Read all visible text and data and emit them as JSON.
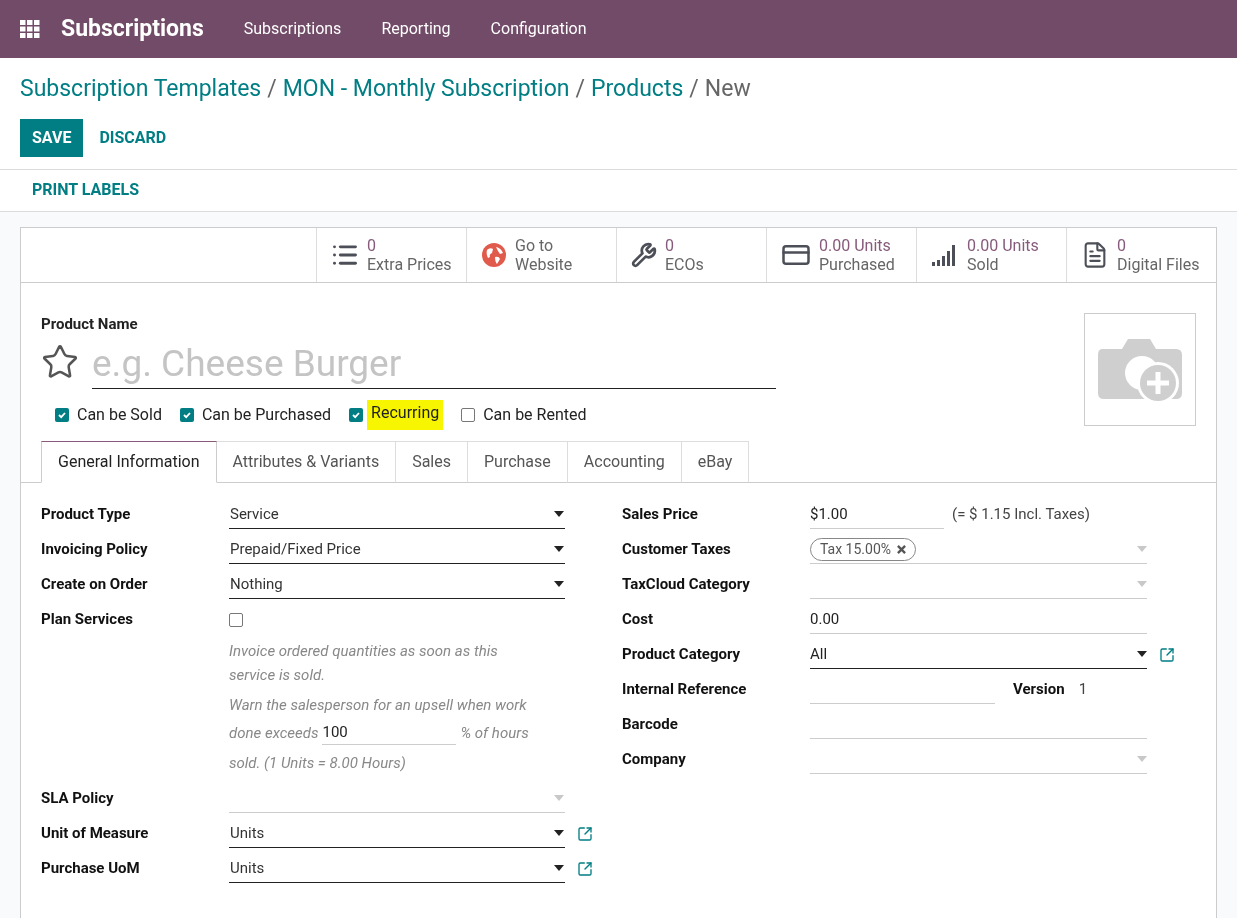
{
  "navbar": {
    "app_name": "Subscriptions",
    "menu": [
      {
        "label": "Subscriptions"
      },
      {
        "label": "Reporting"
      },
      {
        "label": "Configuration"
      }
    ]
  },
  "breadcrumbs": [
    {
      "label": "Subscription Templates",
      "separator": "/"
    },
    {
      "label": "MON - Monthly Subscription",
      "separator": "/"
    },
    {
      "label": "Products",
      "separator": "/"
    }
  ],
  "breadcrumb_current": "New",
  "actions": {
    "save": "SAVE",
    "discard": "DISCARD"
  },
  "print_labels": "PRINT LABELS",
  "smart_buttons": [
    {
      "kind": "list",
      "value": "0",
      "label": "Extra Prices"
    },
    {
      "kind": "globe",
      "title_lines": [
        "Go to",
        "Website"
      ]
    },
    {
      "kind": "wrench",
      "value": "0",
      "label": "ECOs"
    },
    {
      "kind": "card",
      "value": "0.00 Units",
      "label": "Purchased"
    },
    {
      "kind": "bars",
      "value": "0.00 Units",
      "label": "Sold"
    },
    {
      "kind": "file",
      "value": "0",
      "label": "Digital Files"
    }
  ],
  "product_name": {
    "label": "Product Name",
    "placeholder": "e.g. Cheese Burger",
    "favorite": false
  },
  "options": [
    {
      "label": "Can be Sold",
      "checked": true,
      "highlighted": false
    },
    {
      "label": "Can be Purchased",
      "checked": true,
      "highlighted": false
    },
    {
      "label": "Recurring",
      "checked": true,
      "highlighted": true
    },
    {
      "label": "Can be Rented",
      "checked": false,
      "highlighted": false
    }
  ],
  "tabs": [
    {
      "label": "General Information",
      "selected": true
    },
    {
      "label": "Attributes & Variants",
      "selected": false
    },
    {
      "label": "Sales",
      "selected": false
    },
    {
      "label": "Purchase",
      "selected": false
    },
    {
      "label": "Accounting",
      "selected": false
    },
    {
      "label": "eBay",
      "selected": false
    }
  ],
  "left_fields": [
    {
      "kind": "select",
      "label": "Product Type",
      "value": "Service"
    },
    {
      "kind": "select",
      "label": "Invoicing Policy",
      "value": "Prepaid/Fixed Price"
    },
    {
      "kind": "select",
      "label": "Create on Order",
      "value": "Nothing"
    },
    {
      "kind": "checkbox",
      "label": "Plan Services",
      "checked": false
    },
    {
      "kind": "note",
      "text": "Invoice ordered quantities as soon as this service is sold."
    },
    {
      "kind": "upsell",
      "before": "Warn the salesperson for an upsell when work",
      "before_2": "done exceeds",
      "value": "100",
      "after": "% of hours",
      "last": "sold. (1 Units = 8.00 Hours)"
    },
    {
      "kind": "select",
      "label": "SLA Policy"
    },
    {
      "kind": "select",
      "label": "Unit of Measure",
      "value": "Units",
      "external_link": true
    },
    {
      "kind": "select",
      "label": "Purchase UoM",
      "value": "Units",
      "external_link": true
    }
  ],
  "right_fields": [
    {
      "kind": "price",
      "label": "Sales Price",
      "value": "$1.00",
      "suffix": "(= $ 1.15 Incl. Taxes)"
    },
    {
      "kind": "tags",
      "label": "Customer Taxes",
      "tags": [
        "Tax 15.00%"
      ]
    },
    {
      "kind": "select",
      "label": "TaxCloud Category"
    },
    {
      "kind": "text",
      "label": "Cost",
      "value": "0.00"
    },
    {
      "kind": "select",
      "label": "Product Category",
      "value": "All",
      "external_link": true
    },
    {
      "kind": "text_extra",
      "label": "Internal Reference",
      "extra_label": "Version",
      "extra_value": "1"
    },
    {
      "kind": "text",
      "label": "Barcode"
    },
    {
      "kind": "select",
      "label": "Company"
    }
  ]
}
